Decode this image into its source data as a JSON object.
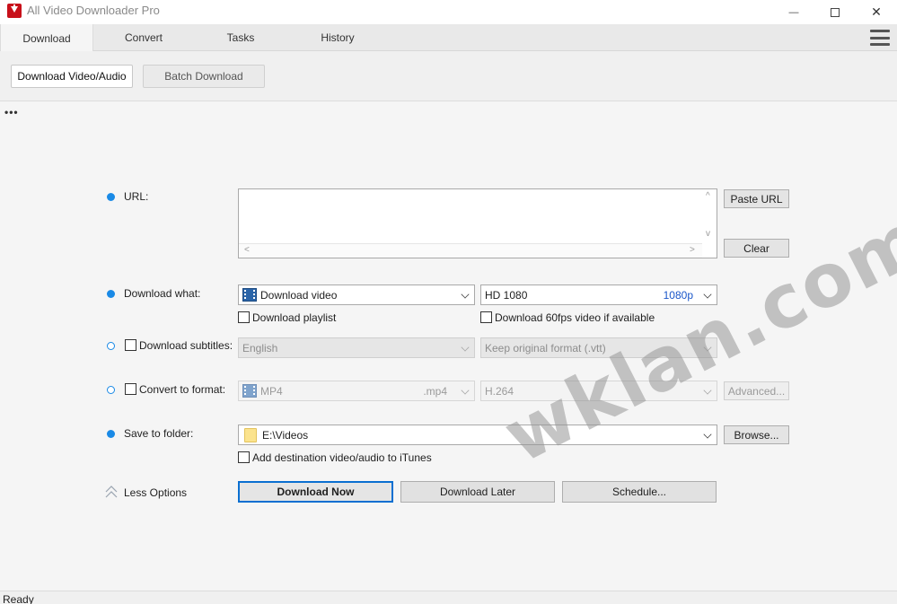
{
  "window": {
    "title": "All Video Downloader Pro",
    "minimize_glyph": "—",
    "maximize_glyph": "☐",
    "close_glyph": "✕"
  },
  "tabs": [
    {
      "label": "Download",
      "active": true
    },
    {
      "label": "Convert",
      "active": false
    },
    {
      "label": "Tasks",
      "active": false
    },
    {
      "label": "History",
      "active": false
    }
  ],
  "subtabs": {
    "download_video_audio": "Download Video/Audio",
    "batch_download": "Batch Download"
  },
  "more_dots": "•••",
  "form": {
    "url": {
      "label": "URL:",
      "value": "",
      "paste_button": "Paste URL",
      "clear_button": "Clear",
      "scroll_left": "<",
      "scroll_right": ">",
      "scroll_up": "^",
      "scroll_down": "v"
    },
    "download_what": {
      "label": "Download what:",
      "type_value": "Download video",
      "quality_value": "HD 1080",
      "quality_tag": "1080p",
      "playlist_label": "Download playlist",
      "fps60_label": "Download 60fps video if available"
    },
    "subtitles": {
      "label": "Download subtitles:",
      "language": "English",
      "format": "Keep original format (.vtt)"
    },
    "convert": {
      "label": "Convert to format:",
      "format": "MP4",
      "extension": ".mp4",
      "codec": "H.264",
      "advanced_button": "Advanced..."
    },
    "save_folder": {
      "label": "Save to folder:",
      "path": "E:\\Videos",
      "browse_button": "Browse...",
      "itunes_label": "Add destination video/audio to iTunes"
    },
    "less_options": "Less Options",
    "download_now": "Download Now",
    "download_later": "Download Later",
    "schedule": "Schedule..."
  },
  "watermark": "wklan.com",
  "status": "Ready",
  "colors": {
    "accent": "#1a8ae6",
    "primary_border": "#0a6fd1",
    "quality_tag": "#1a56c9",
    "app_icon": "#c8101a"
  }
}
